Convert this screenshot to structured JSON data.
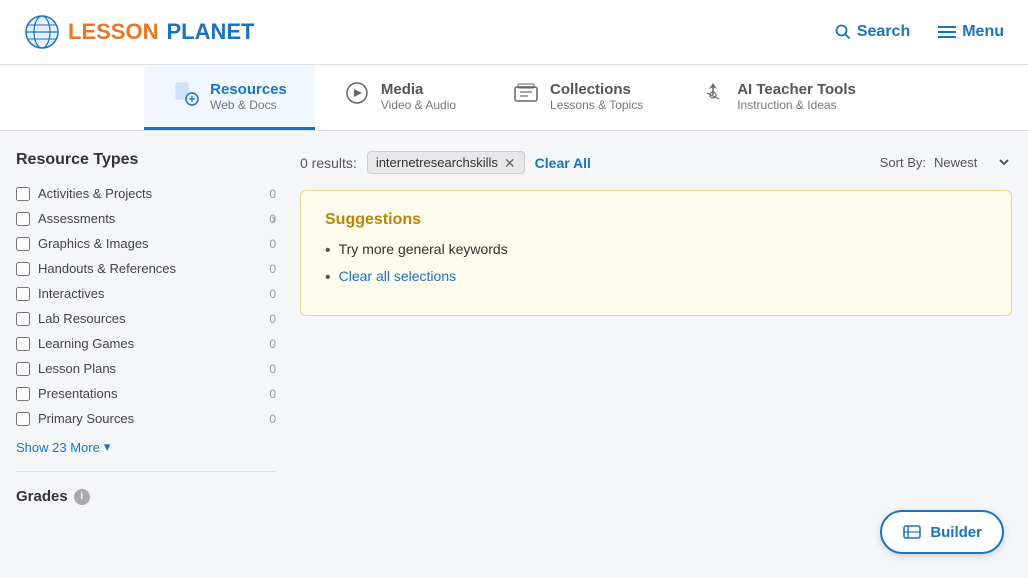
{
  "header": {
    "logo_lesson": "LESSON",
    "logo_planet": "PLANET",
    "search_label": "Search",
    "menu_label": "Menu"
  },
  "nav_tabs": [
    {
      "id": "resources",
      "title": "Resources",
      "sub": "Web & Docs",
      "active": true
    },
    {
      "id": "media",
      "title": "Media",
      "sub": "Video & Audio",
      "active": false
    },
    {
      "id": "collections",
      "title": "Collections",
      "sub": "Lessons & Topics",
      "active": false
    },
    {
      "id": "ai_tools",
      "title": "AI Teacher Tools",
      "sub": "Instruction & Ideas",
      "active": false
    }
  ],
  "sidebar": {
    "resource_types_label": "Resource Types",
    "items": [
      {
        "label": "Activities & Projects",
        "count": "0"
      },
      {
        "label": "Assessments",
        "count": "0",
        "arrow": true
      },
      {
        "label": "Graphics & Images",
        "count": "0"
      },
      {
        "label": "Handouts & References",
        "count": "0"
      },
      {
        "label": "Interactives",
        "count": "0"
      },
      {
        "label": "Lab Resources",
        "count": "0"
      },
      {
        "label": "Learning Games",
        "count": "0"
      },
      {
        "label": "Lesson Plans",
        "count": "0"
      },
      {
        "label": "Presentations",
        "count": "0"
      },
      {
        "label": "Primary Sources",
        "count": "0"
      }
    ],
    "show_more_label": "Show 23 More",
    "grades_label": "Grades"
  },
  "results": {
    "count_label": "0 results:",
    "tag": "internetresearchskills",
    "clear_all_label": "Clear All",
    "sort_label": "Sort By:",
    "sort_value": "Newest"
  },
  "suggestions": {
    "title": "Suggestions",
    "items": [
      {
        "text": "Try more general keywords",
        "link": false
      },
      {
        "text": "Clear all selections",
        "link": true
      }
    ]
  },
  "builder": {
    "label": "Builder"
  }
}
